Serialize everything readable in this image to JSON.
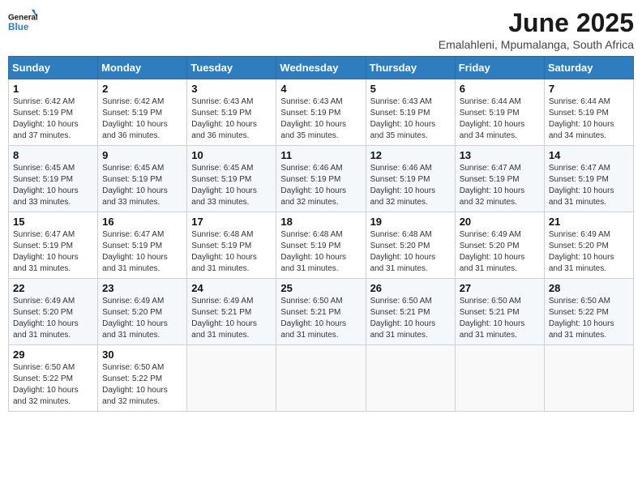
{
  "logo": {
    "line1": "General",
    "line2": "Blue"
  },
  "title": "June 2025",
  "location": "Emalahleni, Mpumalanga, South Africa",
  "weekdays": [
    "Sunday",
    "Monday",
    "Tuesday",
    "Wednesday",
    "Thursday",
    "Friday",
    "Saturday"
  ],
  "weeks": [
    [
      {
        "day": "1",
        "rise": "6:42 AM",
        "set": "5:19 PM",
        "daylight": "10 hours and 37 minutes."
      },
      {
        "day": "2",
        "rise": "6:42 AM",
        "set": "5:19 PM",
        "daylight": "10 hours and 36 minutes."
      },
      {
        "day": "3",
        "rise": "6:43 AM",
        "set": "5:19 PM",
        "daylight": "10 hours and 36 minutes."
      },
      {
        "day": "4",
        "rise": "6:43 AM",
        "set": "5:19 PM",
        "daylight": "10 hours and 35 minutes."
      },
      {
        "day": "5",
        "rise": "6:43 AM",
        "set": "5:19 PM",
        "daylight": "10 hours and 35 minutes."
      },
      {
        "day": "6",
        "rise": "6:44 AM",
        "set": "5:19 PM",
        "daylight": "10 hours and 34 minutes."
      },
      {
        "day": "7",
        "rise": "6:44 AM",
        "set": "5:19 PM",
        "daylight": "10 hours and 34 minutes."
      }
    ],
    [
      {
        "day": "8",
        "rise": "6:45 AM",
        "set": "5:19 PM",
        "daylight": "10 hours and 33 minutes."
      },
      {
        "day": "9",
        "rise": "6:45 AM",
        "set": "5:19 PM",
        "daylight": "10 hours and 33 minutes."
      },
      {
        "day": "10",
        "rise": "6:45 AM",
        "set": "5:19 PM",
        "daylight": "10 hours and 33 minutes."
      },
      {
        "day": "11",
        "rise": "6:46 AM",
        "set": "5:19 PM",
        "daylight": "10 hours and 32 minutes."
      },
      {
        "day": "12",
        "rise": "6:46 AM",
        "set": "5:19 PM",
        "daylight": "10 hours and 32 minutes."
      },
      {
        "day": "13",
        "rise": "6:47 AM",
        "set": "5:19 PM",
        "daylight": "10 hours and 32 minutes."
      },
      {
        "day": "14",
        "rise": "6:47 AM",
        "set": "5:19 PM",
        "daylight": "10 hours and 31 minutes."
      }
    ],
    [
      {
        "day": "15",
        "rise": "6:47 AM",
        "set": "5:19 PM",
        "daylight": "10 hours and 31 minutes."
      },
      {
        "day": "16",
        "rise": "6:47 AM",
        "set": "5:19 PM",
        "daylight": "10 hours and 31 minutes."
      },
      {
        "day": "17",
        "rise": "6:48 AM",
        "set": "5:19 PM",
        "daylight": "10 hours and 31 minutes."
      },
      {
        "day": "18",
        "rise": "6:48 AM",
        "set": "5:19 PM",
        "daylight": "10 hours and 31 minutes."
      },
      {
        "day": "19",
        "rise": "6:48 AM",
        "set": "5:20 PM",
        "daylight": "10 hours and 31 minutes."
      },
      {
        "day": "20",
        "rise": "6:49 AM",
        "set": "5:20 PM",
        "daylight": "10 hours and 31 minutes."
      },
      {
        "day": "21",
        "rise": "6:49 AM",
        "set": "5:20 PM",
        "daylight": "10 hours and 31 minutes."
      }
    ],
    [
      {
        "day": "22",
        "rise": "6:49 AM",
        "set": "5:20 PM",
        "daylight": "10 hours and 31 minutes."
      },
      {
        "day": "23",
        "rise": "6:49 AM",
        "set": "5:20 PM",
        "daylight": "10 hours and 31 minutes."
      },
      {
        "day": "24",
        "rise": "6:49 AM",
        "set": "5:21 PM",
        "daylight": "10 hours and 31 minutes."
      },
      {
        "day": "25",
        "rise": "6:50 AM",
        "set": "5:21 PM",
        "daylight": "10 hours and 31 minutes."
      },
      {
        "day": "26",
        "rise": "6:50 AM",
        "set": "5:21 PM",
        "daylight": "10 hours and 31 minutes."
      },
      {
        "day": "27",
        "rise": "6:50 AM",
        "set": "5:21 PM",
        "daylight": "10 hours and 31 minutes."
      },
      {
        "day": "28",
        "rise": "6:50 AM",
        "set": "5:22 PM",
        "daylight": "10 hours and 31 minutes."
      }
    ],
    [
      {
        "day": "29",
        "rise": "6:50 AM",
        "set": "5:22 PM",
        "daylight": "10 hours and 32 minutes."
      },
      {
        "day": "30",
        "rise": "6:50 AM",
        "set": "5:22 PM",
        "daylight": "10 hours and 32 minutes."
      },
      null,
      null,
      null,
      null,
      null
    ]
  ]
}
